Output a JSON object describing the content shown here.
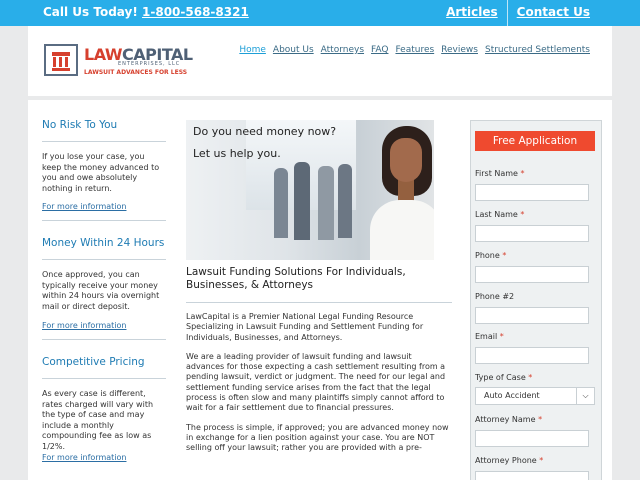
{
  "topbar": {
    "call_label": "Call Us Today!",
    "phone": "1-800-568-8321",
    "links": [
      "Articles",
      "Contact Us"
    ]
  },
  "logo": {
    "law": "LAW",
    "capital": "CAPITAL",
    "enterprises": "ENTERPRISES, LLC",
    "tagline": "LAWSUIT ADVANCES FOR LESS"
  },
  "nav": {
    "items": [
      "Home",
      "About Us",
      "Attorneys",
      "FAQ",
      "Features",
      "Reviews",
      "Structured Settlements"
    ]
  },
  "sidebar": {
    "blocks": [
      {
        "title": "No Risk To You",
        "text": "If you lose your case, you keep the money advanced to you and owe absolutely nothing in return.",
        "link": "For more information"
      },
      {
        "title": "Money Within 24 Hours",
        "text": "Once approved, you can typically receive your money within 24 hours via overnight mail or direct deposit.",
        "link": "For more information"
      },
      {
        "title": "Competitive Pricing",
        "text": "As every case is different, rates charged will vary with the type of case and may include a monthly compounding fee as low as 1/2%.",
        "link": "For more information"
      }
    ]
  },
  "hero": {
    "line1": "Do you need money now?",
    "line2": "Let us help you."
  },
  "main": {
    "heading": "Lawsuit Funding Solutions For Individuals, Businesses, & Attorneys",
    "paragraphs": [
      "LawCapital is a Premier National Legal Funding Resource Specializing in Lawsuit Funding and Settlement Funding for Individuals, Businesses, and Attorneys.",
      "We are a leading provider of lawsuit funding and lawsuit advances for those expecting a cash settlement resulting from a pending lawsuit, verdict or judgment. The need for our legal and settlement funding service arises from the fact that the legal process is often slow and many plaintiffs simply cannot afford to wait for a fair settlement due to financial pressures.",
      "The process is simple, if approved; you are advanced money now in exchange for a lien position against your case. You are NOT selling off your lawsuit; rather you are provided with a pre-"
    ]
  },
  "form": {
    "title": "Free Application",
    "fields": {
      "first_name": "First Name",
      "last_name": "Last Name",
      "phone": "Phone",
      "phone2": "Phone #2",
      "email": "Email",
      "case_type": "Type of Case",
      "attorney_name": "Attorney Name",
      "attorney_phone": "Attorney Phone"
    },
    "required_mark": "*",
    "case_type_value": "Auto Accident"
  },
  "colors": {
    "topbar": "#29aee9",
    "accent_red": "#ef4a2f",
    "link_blue": "#1e7bb3"
  }
}
